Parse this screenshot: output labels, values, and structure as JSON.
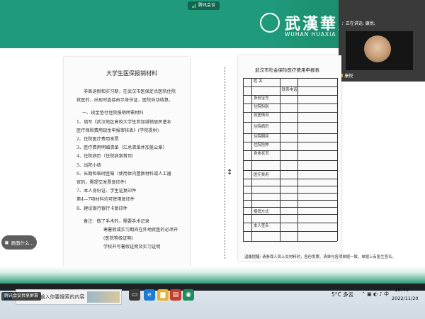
{
  "meeting": {
    "title": "腾讯会议",
    "speaking": "正在讲话: 康悦;",
    "participant_name": "康悦",
    "self_label": "腾讯会议共享屏幕"
  },
  "school": {
    "name_cn": "武漢華夏理",
    "name_en": "WUHAN HUAXIA UNIVERSI"
  },
  "left_doc": {
    "title": "大学生医保报销材料",
    "lines": [
      "非离退假和实习期，在武汉市医保定点医院住院",
      "就医的，出现时直接由示身份证，医院自动结算。",
      "",
      "一、现金垫付住院报销所需材料",
      "1、填写《武汉地区高校大学生参加城镇居民基本",
      "医疗保险费用现金申报审核表》(学院提供)",
      "2、住院医疗费用发票",
      "3、医疗费用明细清单（汇总清单并加盖公章）",
      "4、住院病历（住院病案首页）",
      "5、出院小结",
      "6、长期和临时医嘱（使用体内置换材料或人工器",
      "官的，需提交发票复印件）",
      "7、本人身份证、学生证复印件",
      "第4—7项材料均可使用复印件",
      "8、建设银行银行卡复印件",
      "",
      "备注：做了手术的，需要手术记录",
      "寒暑假或实习期间在外地就医的必须开",
      "(医院等级证明)",
      "学校开写暑假证明及实习证明"
    ]
  },
  "right_doc": {
    "title": "武汉市社会保险医疗费用申报表",
    "fields": [
      "姓 名",
      "联系电话",
      "身份证号",
      "住院科别",
      "就医情况",
      "住院病历",
      "住院期间",
      "住院险种",
      "身体状况"
    ],
    "subtitles": [
      "医疗费用",
      "报销方式",
      "本人签名"
    ],
    "footer": "温馨提醒: 请参保人员上交材料时，各份发票、清单与各项单据一致，单据上有医生签名。"
  },
  "taskbar": {
    "search_placeholder": "在这里输入你要搜索的内容",
    "weather": "5°C 多云",
    "time": "18:40",
    "date": "2022/11/20"
  },
  "side_button": "画面什么...",
  "colors": {
    "banner": "#1f9a7a",
    "panel": "#3a3a3a",
    "taskbar": "#dfe7ee"
  }
}
